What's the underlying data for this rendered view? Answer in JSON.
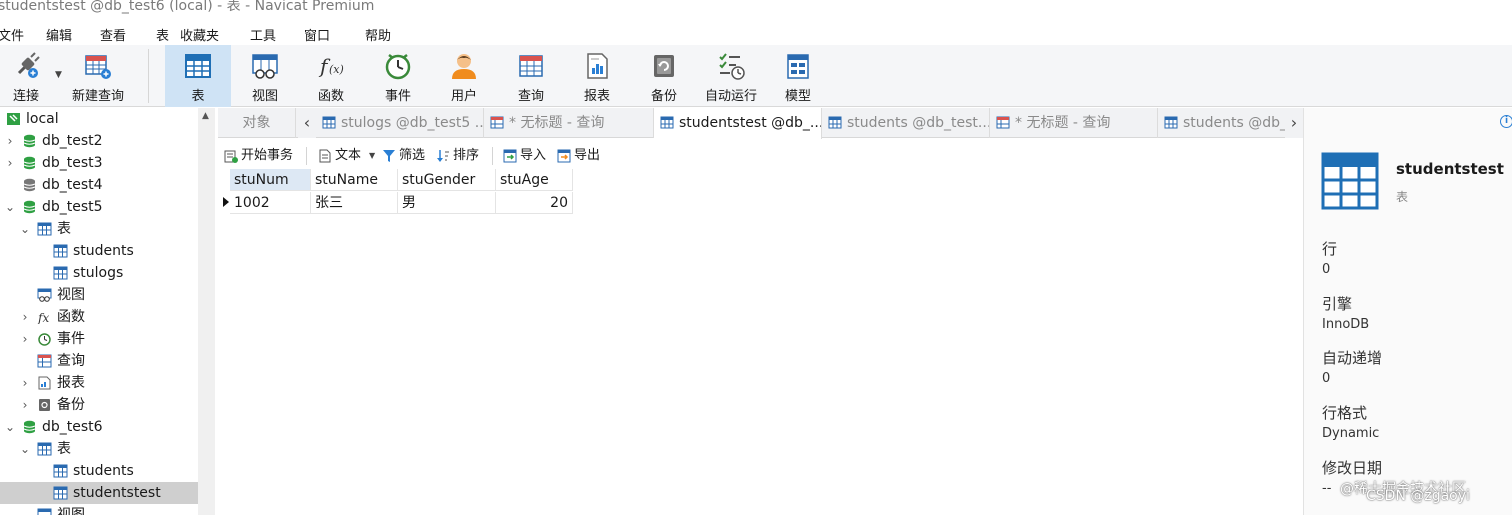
{
  "window": {
    "title": "studentstest @db_test6 (local) - 表 - Navicat Premium"
  },
  "menu": [
    "文件",
    "编辑",
    "查看",
    "表",
    "收藏夹",
    "工具",
    "窗口",
    "帮助"
  ],
  "toolbar": {
    "connect": "连接",
    "new_query": "新建查询",
    "table": "表",
    "view": "视图",
    "function": "函数",
    "event": "事件",
    "user": "用户",
    "query": "查询",
    "report": "报表",
    "backup": "备份",
    "automation": "自动运行",
    "model": "模型"
  },
  "tree": {
    "nodes": [
      {
        "label": "local"
      },
      {
        "label": "db_test2"
      },
      {
        "label": "db_test3"
      },
      {
        "label": "db_test4"
      },
      {
        "label": "db_test5"
      },
      {
        "label": "表"
      },
      {
        "label": "students"
      },
      {
        "label": "stulogs"
      },
      {
        "label": "视图"
      },
      {
        "label": "函数"
      },
      {
        "label": "事件"
      },
      {
        "label": "查询"
      },
      {
        "label": "报表"
      },
      {
        "label": "备份"
      },
      {
        "label": "db_test6"
      },
      {
        "label": "表"
      },
      {
        "label": "students"
      },
      {
        "label": "studentstest"
      },
      {
        "label": "视图"
      }
    ]
  },
  "tabs": {
    "objects": "对象",
    "items": [
      {
        "label": "stulogs @db_test5 ..."
      },
      {
        "label": "* 无标题 - 查询"
      },
      {
        "label": "studentstest @db_..."
      },
      {
        "label": "students @db_test..."
      },
      {
        "label": "* 无标题 - 查询"
      },
      {
        "label": "students @db_"
      }
    ]
  },
  "data_toolbar": {
    "begin_transaction": "开始事务",
    "text": "文本",
    "filter": "筛选",
    "sort": "排序",
    "import": "导入",
    "export": "导出"
  },
  "grid": {
    "columns": [
      "stuNum",
      "stuName",
      "stuGender",
      "stuAge"
    ],
    "rows": [
      [
        "1002",
        "张三",
        "男",
        "20"
      ]
    ]
  },
  "info": {
    "name": "studentstest",
    "type": "表",
    "props": [
      {
        "label": "行",
        "value": "0"
      },
      {
        "label": "引擎",
        "value": "InnoDB"
      },
      {
        "label": "自动递增",
        "value": "0"
      },
      {
        "label": "行格式",
        "value": "Dynamic"
      },
      {
        "label": "修改日期",
        "value": "--"
      }
    ]
  },
  "watermark": {
    "line1": "@稀土掘金技术社区",
    "line2": "CSDN @zgaoyi"
  },
  "colors": {
    "accent": "#1f6fb5",
    "db_green": "#2fa043",
    "active_tool": "#cfe3f5"
  }
}
